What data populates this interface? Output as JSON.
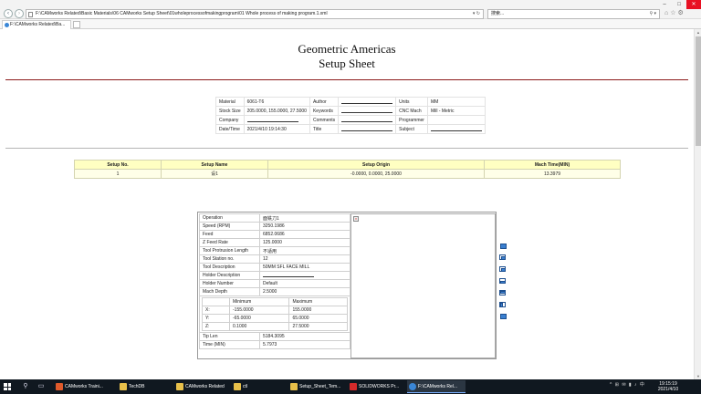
{
  "browser": {
    "address": "F:\\CAMworks Related\\Basic Materials\\06 CAMworks Setup Sheet\\01wholeprocessofmakingprogram\\01 Whole process of making program.1.xml",
    "search_placeholder": "搜索...",
    "tab_title": "F:\\CAMworks Related\\Ba..."
  },
  "sheet": {
    "title_line1": "Geometric Americas",
    "title_line2": "Setup Sheet",
    "info": {
      "material_label": "Material",
      "material_value": "6061-T6",
      "author_label": "Author",
      "units_label": "Units",
      "units_value": "MM",
      "stock_label": "Stock Size",
      "stock_value": "205.0000, 155.0000, 27.5000",
      "keywords_label": "Keywords",
      "cnc_label": "CNC Mach",
      "cnc_value": "Mill - Metric",
      "company_label": "Company",
      "comments_label": "Comments",
      "programmer_label": "Programmer",
      "date_label": "Date/Time",
      "date_value": "2021/4/10 19:14:30",
      "title_label": "Title",
      "subject_label": "Subject"
    },
    "setup": {
      "headers": [
        "Setup No.",
        "Setup Name",
        "Setup Origin",
        "Mach Time(MIN)"
      ],
      "row": [
        "1",
        "设1",
        "-0.0000, 0.0000, 25.0000",
        "13.3979"
      ]
    },
    "operation": {
      "rows": [
        {
          "label": "Operation",
          "value": "面铣刀1"
        },
        {
          "label": "Speed (RPM)",
          "value": "3250.1986"
        },
        {
          "label": "Feed",
          "value": "6852.0686"
        },
        {
          "label": "Z Feed Rate",
          "value": "125.0000"
        },
        {
          "label": "Tool Protrusion Length",
          "value": "不适用"
        },
        {
          "label": "Tool Station no.",
          "value": "12"
        },
        {
          "label": "Tool Description",
          "value": "50MM SFL FACE MILL"
        },
        {
          "label": "Holder Description",
          "value": ""
        },
        {
          "label": "Holder Number",
          "value": "Default"
        },
        {
          "label": "Mach Depth",
          "value": "2.5000"
        }
      ],
      "minmax": {
        "min_label": "Minimum",
        "max_label": "Maximum",
        "x_label": "X:",
        "x_min": "-155.0000",
        "x_max": "155.0000",
        "y_label": "Y:",
        "y_min": "-65.0000",
        "y_max": "65.0000",
        "z_label": "Z:",
        "z_min": "0.1000",
        "z_max": "27.5000"
      },
      "tip_len_label": "Tip Len",
      "tip_len_value": "5184.3095",
      "time_label": "Time (MIN)",
      "time_value": "5.7973"
    }
  },
  "taskbar": {
    "apps": [
      "CAMworks Traini...",
      "TechDB",
      "CAMworks Related",
      "ctl",
      "Setup_Sheet_Tem...",
      "SOLIDWORKS Pr...",
      "F:\\CAMworks Rel..."
    ],
    "time": "19:15:19",
    "date": "2021/4/10"
  },
  "colors": {
    "accent_rule": "#8b1a1a",
    "setup_header": "#ffffc2",
    "close_button": "#e81123"
  }
}
